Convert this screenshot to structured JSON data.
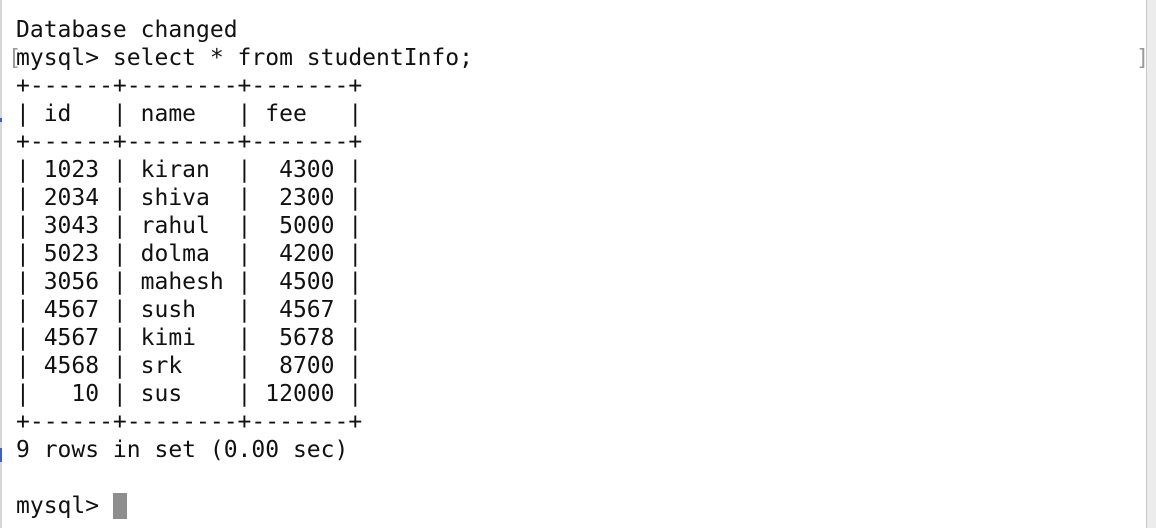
{
  "terminal": {
    "lines": [
      "Database changed",
      "mysql> select * from studentInfo;",
      "+------+--------+-------+",
      "| id   | name   | fee   |",
      "+------+--------+-------+",
      "| 1023 | kiran  |  4300 |",
      "| 2034 | shiva  |  2300 |",
      "| 3043 | rahul  |  5000 |",
      "| 5023 | dolma  |  4200 |",
      "| 3056 | mahesh |  4500 |",
      "| 4567 | sush   |  4567 |",
      "| 4567 | kimi   |  5678 |",
      "| 4568 | srk    |  8700 |",
      "|   10 | sus    | 12000 |",
      "+------+--------+-------+",
      "9 rows in set (0.00 sec)",
      "",
      "mysql> "
    ]
  },
  "colors": {
    "background": "#ffffff",
    "text": "#111111",
    "cursor": "#8e8e8e"
  }
}
